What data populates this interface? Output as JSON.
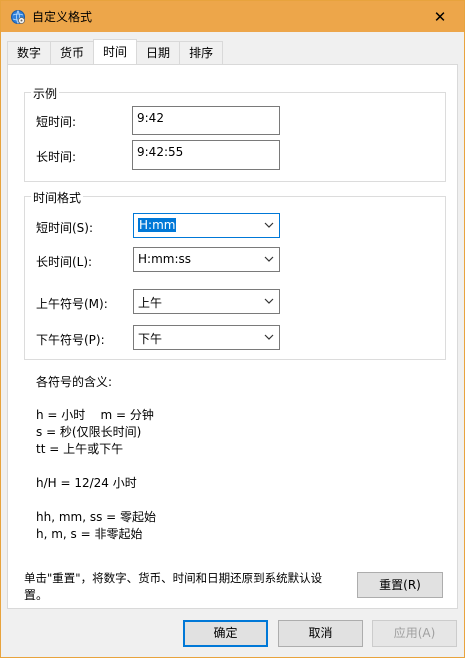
{
  "window": {
    "title": "自定义格式",
    "close_label": "✕",
    "titlebar_color": "#eda64a",
    "app_icon": "globe-gear-icon"
  },
  "tabs": [
    {
      "label": "数字",
      "active": false
    },
    {
      "label": "货币",
      "active": false
    },
    {
      "label": "时间",
      "active": true
    },
    {
      "label": "日期",
      "active": false
    },
    {
      "label": "排序",
      "active": false
    }
  ],
  "sample": {
    "group_title": "示例",
    "short_label": "短时间:",
    "short_value": "9:42",
    "long_label": "长时间:",
    "long_value": "9:42:55"
  },
  "formats": {
    "group_title": "时间格式",
    "short_label": "短时间(S):",
    "short_value": "H:mm",
    "long_label": "长时间(L):",
    "long_value": "H:mm:ss",
    "am_label": "上午符号(M):",
    "am_value": "上午",
    "pm_label": "下午符号(P):",
    "pm_value": "下午"
  },
  "legend": {
    "heading": "各符号的含义:",
    "line1": "h = 小时    m = 分钟",
    "line2": "s = 秒(仅限长时间)",
    "line3": "tt = 上午或下午",
    "line4": "h/H = 12/24 小时",
    "line5": "hh, mm, ss = 零起始",
    "line6": "h, m, s = 非零起始"
  },
  "reset": {
    "note_line1": "单击\"重置\"，将数字、货币、时间和日期还原到系统默认设",
    "note_line2": "置。",
    "button": "重置(R)"
  },
  "footer": {
    "ok": "确定",
    "cancel": "取消",
    "apply": "应用(A)"
  }
}
